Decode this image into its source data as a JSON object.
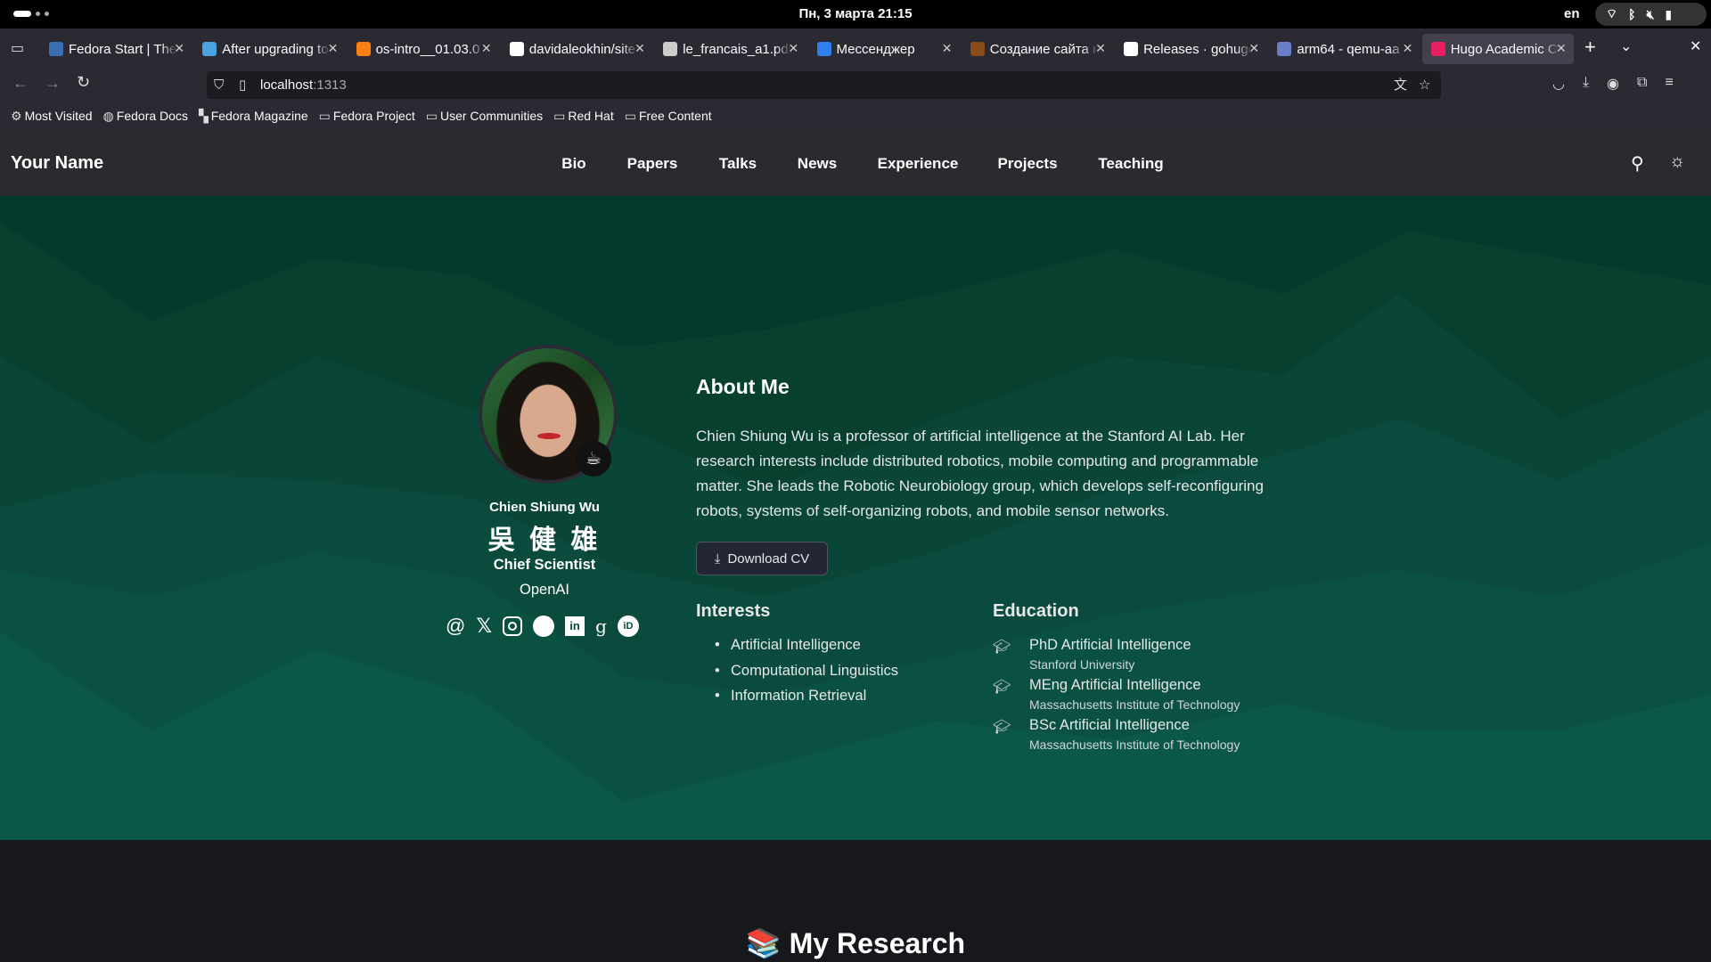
{
  "system": {
    "date_time": "Пн, 3 марта  21:15",
    "keyboard_layout": "en"
  },
  "browser": {
    "tabs": [
      {
        "title": "Fedora Start | The",
        "icon": "fedora-icon",
        "color": "#3c6eb4"
      },
      {
        "title": "After upgrading to",
        "icon": "discourse-icon",
        "color": "#4aa3df"
      },
      {
        "title": "os-intro__01.03.0",
        "icon": "moodle-icon",
        "color": "#f98012"
      },
      {
        "title": "davidaleokhin/site",
        "icon": "github-icon",
        "color": "#ffffff"
      },
      {
        "title": "le_francais_a1.pdf",
        "icon": "pdf-icon",
        "color": "#cccccc"
      },
      {
        "title": "Мессенджер",
        "icon": "messenger-icon",
        "color": "#2f80ed"
      },
      {
        "title": "Создание сайта н",
        "icon": "site-icon",
        "color": "#8a4b1a"
      },
      {
        "title": "Releases · gohugo",
        "icon": "github-icon",
        "color": "#ffffff"
      },
      {
        "title": "arm64 - qemu-aa",
        "icon": "qemu-icon",
        "color": "#6b7fc8"
      },
      {
        "title": "Hugo Academic C",
        "icon": "hugo-icon",
        "color": "#e91e63",
        "active": true
      }
    ],
    "url_host": "localhost",
    "url_port": ":1313",
    "bookmarks": [
      {
        "label": "Most Visited",
        "icon": "gear-icon"
      },
      {
        "label": "Fedora Docs",
        "icon": "globe-icon"
      },
      {
        "label": "Fedora Magazine",
        "icon": "fm-icon"
      },
      {
        "label": "Fedora Project",
        "icon": "folder-icon"
      },
      {
        "label": "User Communities",
        "icon": "folder-icon"
      },
      {
        "label": "Red Hat",
        "icon": "folder-icon"
      },
      {
        "label": "Free Content",
        "icon": "folder-icon"
      }
    ]
  },
  "site": {
    "brand": "Your Name",
    "nav": [
      "Bio",
      "Papers",
      "Talks",
      "News",
      "Experience",
      "Projects",
      "Teaching"
    ]
  },
  "profile": {
    "name": "Chien Shiung Wu",
    "name_cn": "吳 健 雄",
    "role": "Chief Scientist",
    "org": "OpenAI",
    "status_emoji": "☕",
    "social": [
      "email-icon",
      "x-icon",
      "instagram-icon",
      "github-icon",
      "linkedin-icon",
      "google-scholar-icon",
      "orcid-icon"
    ]
  },
  "about": {
    "title": "About Me",
    "bio": "Chien Shiung Wu is a professor of artificial intelligence at the Stanford AI Lab. Her research interests include distributed robotics, mobile computing and programmable matter. She leads the Robotic Neurobiology group, which develops self-reconfiguring robots, systems of self-organizing robots, and mobile sensor networks.",
    "cv_button": "Download CV",
    "interests_title": "Interests",
    "interests": [
      "Artificial Intelligence",
      "Computational Linguistics",
      "Information Retrieval"
    ],
    "education_title": "Education",
    "education": [
      {
        "degree": "PhD Artificial Intelligence",
        "school": "Stanford University"
      },
      {
        "degree": "MEng Artificial Intelligence",
        "school": "Massachusetts Institute of Technology"
      },
      {
        "degree": "BSc Artificial Intelligence",
        "school": "Massachusetts Institute of Technology"
      }
    ]
  },
  "research": {
    "emoji": "📚",
    "title": "My Research"
  },
  "colors": {
    "hero_top": "#023a2c",
    "hero_bottom": "#045a4b",
    "nav_bg": "#2a2b2f",
    "page_bg": "#17181c"
  }
}
